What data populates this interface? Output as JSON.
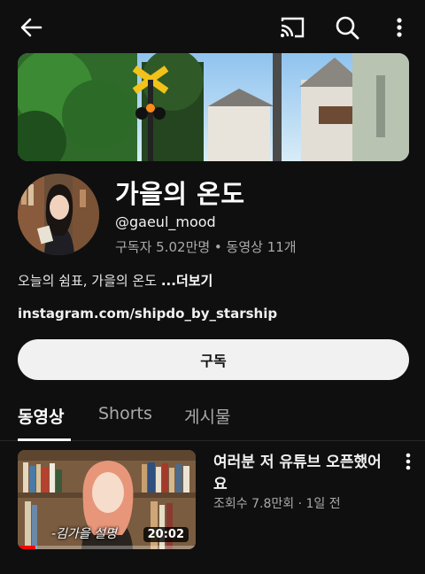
{
  "topbar": {
    "back_icon": "arrow-left-icon",
    "cast_icon": "cast-icon",
    "search_icon": "search-icon",
    "more_icon": "more-vertical-icon"
  },
  "channel": {
    "name": "가을의 온도",
    "handle": "@gaeul_mood",
    "stats": "구독자 5.02만명 • 동영상 11개",
    "description": "오늘의 쉼표, 가을의 온도 ",
    "more_label": "...더보기",
    "link": "instagram.com/shipdo_by_starship",
    "subscribe_label": "구독"
  },
  "tabs": [
    {
      "label": "동영상",
      "active": true
    },
    {
      "label": "Shorts",
      "active": false
    },
    {
      "label": "게시물",
      "active": false
    }
  ],
  "videos": [
    {
      "title": "여러분 저 유튜브 오픈했어요",
      "meta": "조회수 7.8만회 · 1일 전",
      "duration": "20:02",
      "thumbnail_caption": "-김가을 설명",
      "watched_fraction": 0.1
    }
  ],
  "colors": {
    "background": "#0f0f0f",
    "subscribe_bg": "#f1f1f1",
    "progress": "#ff0000"
  }
}
